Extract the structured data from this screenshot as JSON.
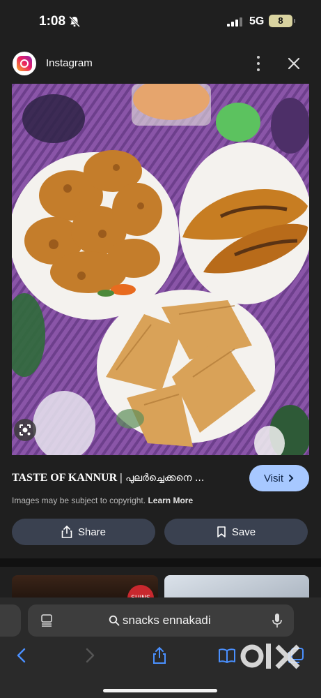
{
  "status_bar": {
    "time": "1:08",
    "network": "5G",
    "battery": "8"
  },
  "source": {
    "name": "Instagram",
    "logo_icon": "instagram-icon"
  },
  "result": {
    "title_bold": "TASTE OF KANNUR |",
    "title_rest": " പുലർച്ചെക്കനെ ...",
    "visit_label": "Visit",
    "copyright_text": "Images may be subject to copyright.",
    "learn_more": "Learn More",
    "share_label": "Share",
    "save_label": "Save"
  },
  "thumbnail": {
    "badge_text": "SUINS"
  },
  "browser": {
    "url_text": "snacks ennakadi"
  },
  "colors": {
    "visit_bg": "#a7c8ff",
    "button_bg": "#3a4150",
    "background": "#1f1f1f"
  }
}
